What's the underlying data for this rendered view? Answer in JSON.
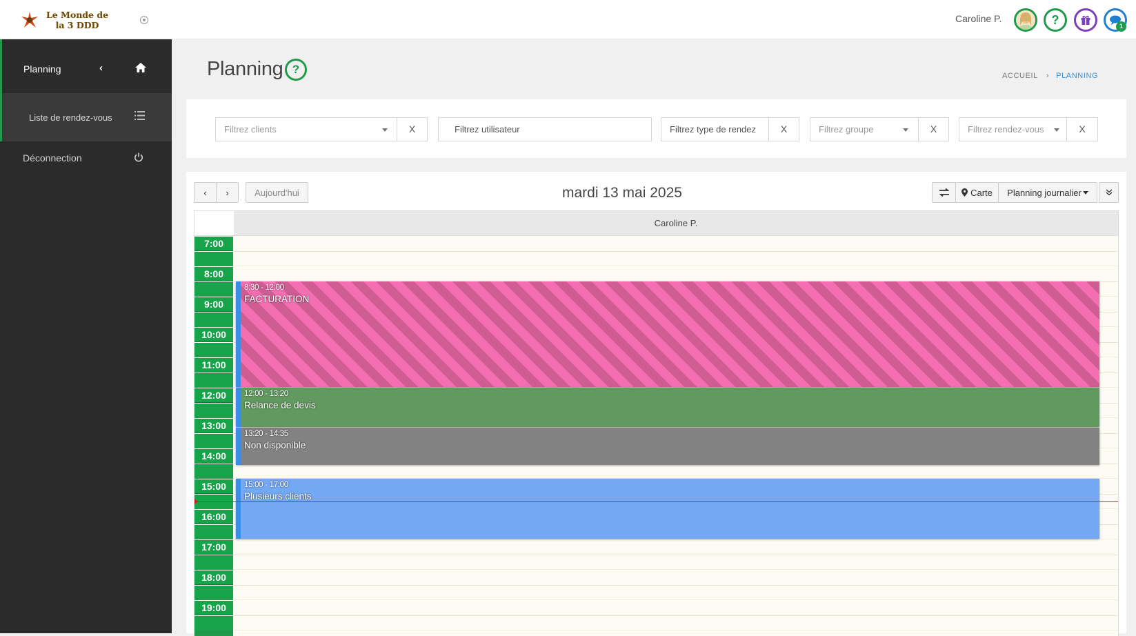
{
  "app": {
    "logo_text": "Le Monde de la 3 DDD",
    "user_name": "Caroline P.",
    "chat_badge": "1",
    "help_icon": "question-circle-icon",
    "gift_icon": "gift-icon",
    "chat_icon": "chat-icon"
  },
  "sidebar": {
    "planning_label": "Planning",
    "sub_label": "Liste de rendez-vous",
    "logout_label": "Déconnection"
  },
  "header": {
    "title": "Planning",
    "breadcrumb_home": "ACCUEIL",
    "breadcrumb_sep": "›",
    "breadcrumb_current": "PLANNING"
  },
  "filters": {
    "clients": "Filtrez clients",
    "utilisateur": "Filtrez utilisateur",
    "type": "Filtrez type de rendez",
    "groupe": "Filtrez groupe",
    "rendez_vous": "Filtrez rendez-vous",
    "clear": "X"
  },
  "calendar": {
    "prev": "‹",
    "next": "›",
    "today": "Aujourd'hui",
    "date": "mardi 13 mai 2025",
    "swap_icon": "swap-icon",
    "map_label": "Carte",
    "view_label": "Planning journalier",
    "expand_icon": "double-chevron-down-icon",
    "column": "Caroline P.",
    "hours": [
      "7:00",
      "8:00",
      "9:00",
      "10:00",
      "11:00",
      "12:00",
      "13:00",
      "14:00",
      "15:00",
      "16:00",
      "17:00",
      "18:00",
      "19:00"
    ]
  },
  "events": [
    {
      "time": "8:30 - 12:00",
      "name": "FACTURATION",
      "color": "#f36fb1"
    },
    {
      "time": "12:00 - 13:20",
      "name": "Relance de devis",
      "color": "#61995e"
    },
    {
      "time": "13:20 - 14:35",
      "name": "Non disponible",
      "color": "#828282"
    },
    {
      "time": "15:00 - 17:00",
      "name": "Plusieurs clients",
      "color": "#73a9f2"
    }
  ],
  "colors": {
    "accent": "#1f9a4a",
    "sidebar": "#2b2b2b",
    "breadcrumb_active": "#3a8fd0",
    "now_line": "#d02020"
  }
}
